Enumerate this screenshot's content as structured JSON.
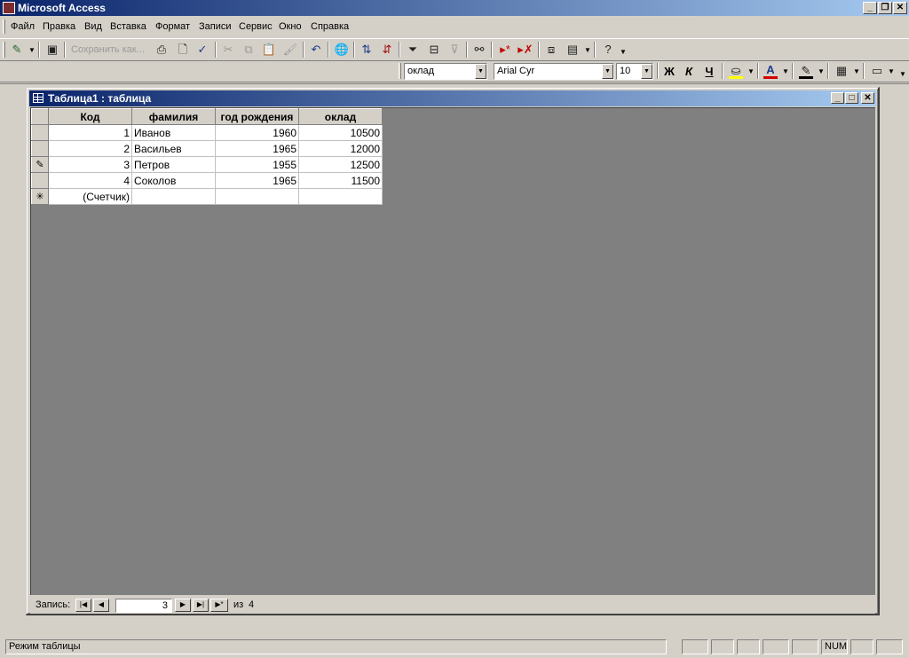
{
  "app": {
    "title": "Microsoft Access"
  },
  "menu": [
    "Файл",
    "Правка",
    "Вид",
    "Вставка",
    "Формат",
    "Записи",
    "Сервис",
    "Окно",
    "Справка"
  ],
  "toolbar": {
    "save_as_label": "Сохранить как...",
    "icons": [
      "view-icon",
      "save-icon",
      "print-icon",
      "print-preview-icon",
      "spelling-icon",
      "cut-icon",
      "copy-icon",
      "paste-icon",
      "format-painter-icon",
      "undo-icon",
      "hyperlink-icon",
      "sort-ascending-icon",
      "sort-descending-icon",
      "filter-by-selection-icon",
      "filter-by-form-icon",
      "apply-filter-icon",
      "find-icon",
      "new-record-icon",
      "delete-record-icon",
      "database-window-icon",
      "new-object-icon",
      "help-icon"
    ]
  },
  "format_toolbar": {
    "field_select": "оклад",
    "font": "Arial Cyr",
    "font_size": "10",
    "bold": "Ж",
    "italic": "К",
    "underline": "Ч",
    "font_color": "A",
    "colors": {
      "font_color_bar": "#d40000",
      "fill_color_bar": "#ffff00"
    }
  },
  "child_window": {
    "title": "Таблица1 : таблица",
    "columns": [
      "Код",
      "фамилия",
      "год рождения",
      "оклад"
    ],
    "rows": [
      {
        "selector": "",
        "cells": [
          "1",
          "Иванов",
          "1960",
          "10500"
        ]
      },
      {
        "selector": "",
        "cells": [
          "2",
          "Васильев",
          "1965",
          "12000"
        ]
      },
      {
        "selector": "✎",
        "cells": [
          "3",
          "Петров",
          "1955",
          "12500"
        ]
      },
      {
        "selector": "",
        "cells": [
          "4",
          "Соколов",
          "1965",
          "11500"
        ]
      }
    ],
    "new_row": {
      "selector": "✳",
      "counter": "(Счетчик)"
    }
  },
  "navigation": {
    "label": "Запись:",
    "current": "3",
    "of_label": "из",
    "total": "4"
  },
  "status": {
    "mode": "Режим таблицы",
    "num": "NUM"
  }
}
